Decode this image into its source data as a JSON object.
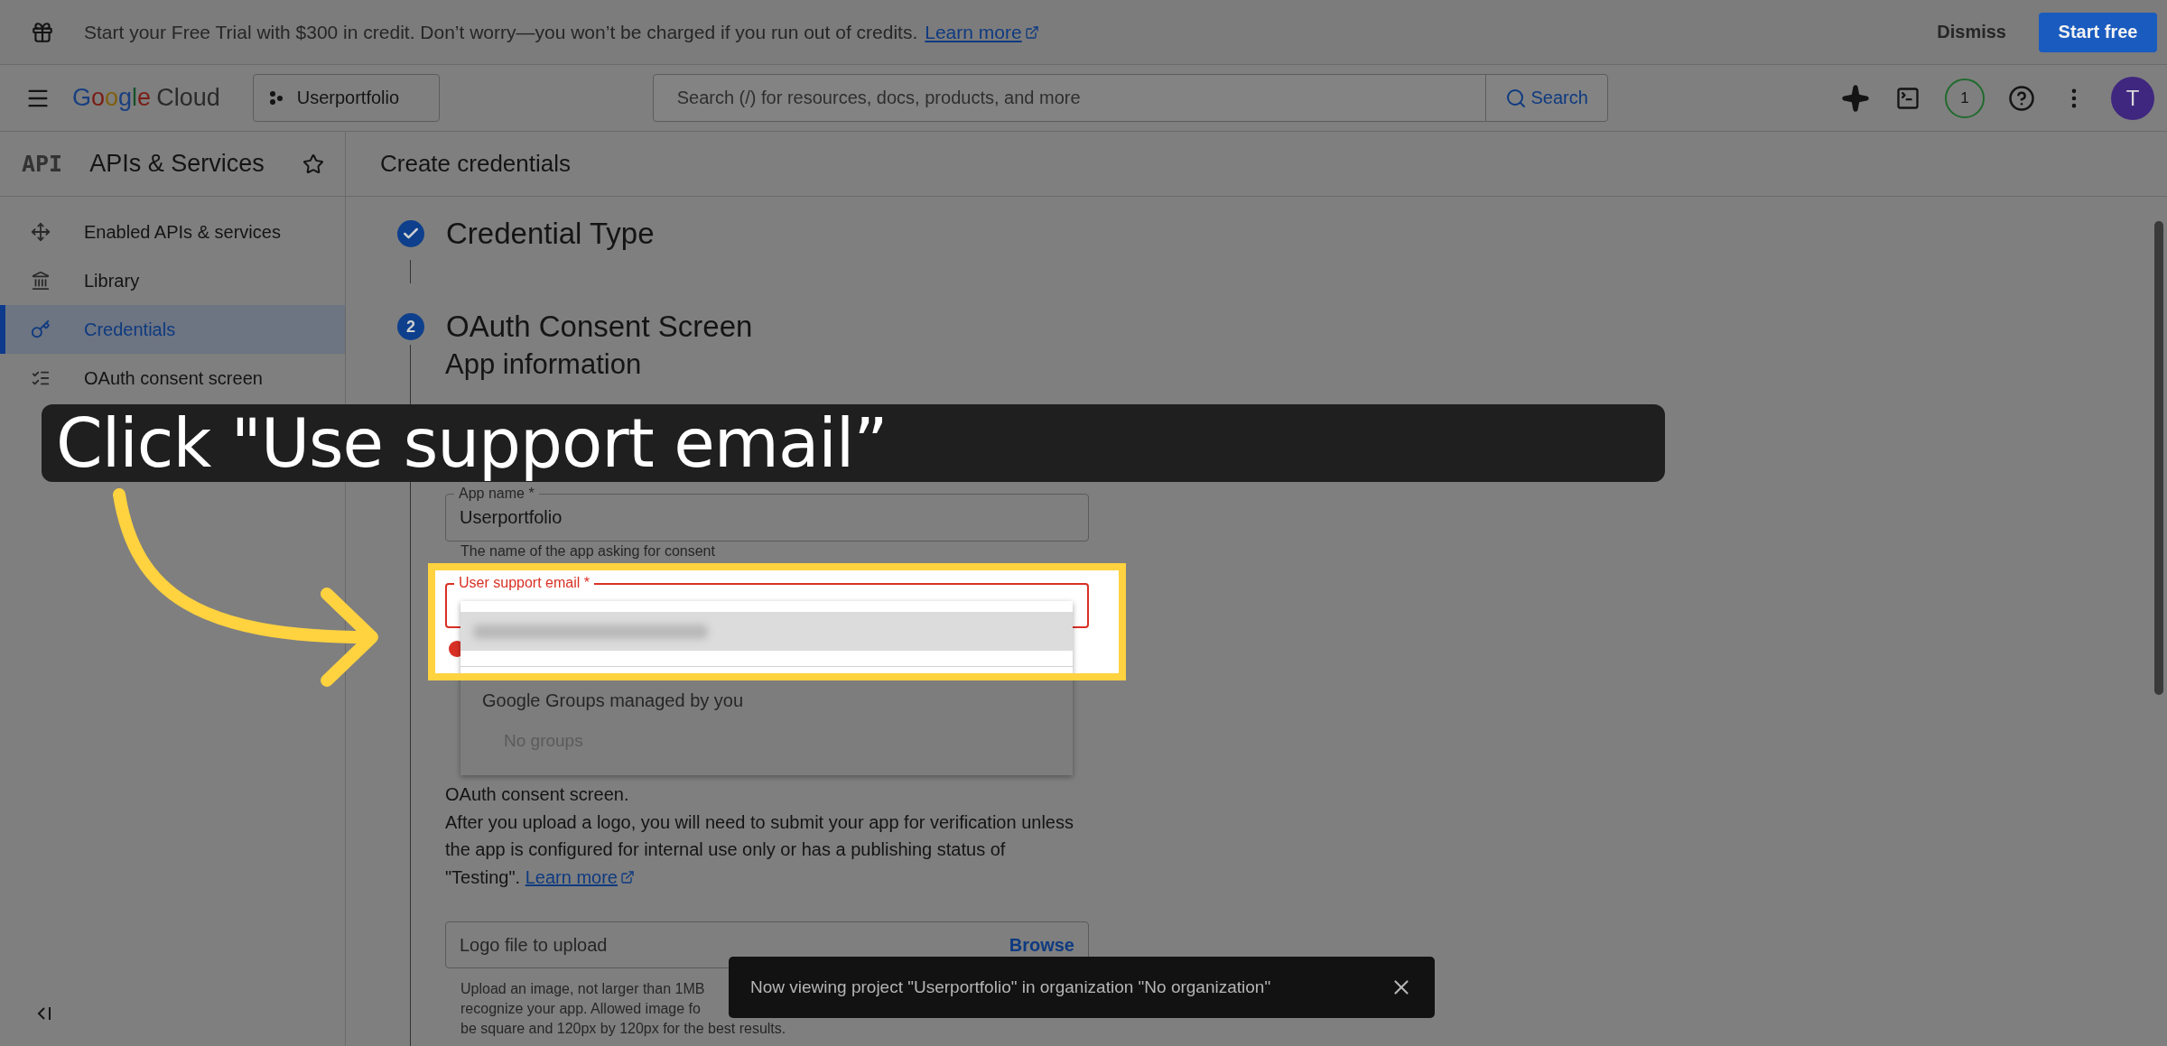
{
  "promo_banner": {
    "message": "Start your Free Trial with $300 in credit. Don’t worry—you won’t be charged if you run out of credits.",
    "link": "Learn more",
    "dismiss": "Dismiss",
    "cta": "Start free"
  },
  "header": {
    "logo": {
      "brand": "Google",
      "product": "Cloud"
    },
    "project": "Userportfolio",
    "search": {
      "placeholder": "Search (/) for resources, docs, products, and more",
      "button": "Search"
    },
    "notifications": "1",
    "avatar": "T"
  },
  "sidebar": {
    "logo": "API",
    "title": "APIs & Services",
    "items": [
      {
        "label": "Enabled APIs & services",
        "selected": false
      },
      {
        "label": "Library",
        "selected": false
      },
      {
        "label": "Credentials",
        "selected": true
      },
      {
        "label": "OAuth consent screen",
        "selected": false
      }
    ]
  },
  "main": {
    "title": "Create credentials",
    "steps": [
      {
        "label": "Credential Type",
        "completed": true
      },
      {
        "number": "2",
        "label": "OAuth Consent Screen",
        "completed": false
      }
    ],
    "form": {
      "section_title": "App information",
      "app_name": {
        "label": "App name *",
        "value": "Userportfolio",
        "hint": "The name of the app asking for consent"
      },
      "support_email": {
        "label": "User support email *",
        "error": true,
        "menu": {
          "group_header": "Google Groups managed by you",
          "empty_text": "No groups"
        }
      },
      "logo_intro": "OAuth consent screen.",
      "logo_text": "After you upload a logo, you will need to submit your app for verification unless the app is configured for internal use only or has a publishing status of \"Testing\".",
      "learn_more": "Learn more",
      "logo_field": {
        "placeholder": "Logo file to upload",
        "button": "Browse"
      },
      "logo_hint": [
        "Upload an image, not larger than 1MB",
        "recognize your app. Allowed image fo",
        "be square and 120px by 120px for the best results."
      ]
    }
  },
  "snackbar": {
    "message": "Now viewing project \"Userportfolio\" in organization \"No organization\""
  },
  "tutorial": {
    "caption": "Click \"Use support email”"
  }
}
